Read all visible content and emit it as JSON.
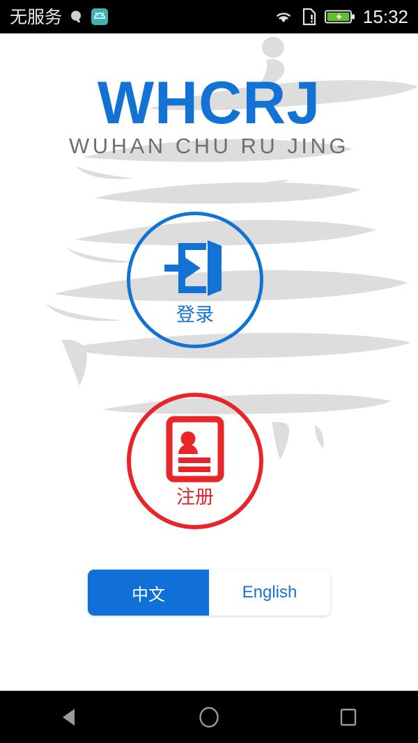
{
  "status_bar": {
    "carrier": "无服务",
    "clock": "15:32",
    "icons": {
      "search": "search-q-icon",
      "app": "android-app-icon",
      "wifi": "wifi-icon",
      "sim": "sim-card-alert-icon",
      "battery": "battery-charging-icon"
    },
    "colors": {
      "background": "#000000",
      "text": "#f0f0f0",
      "battery_fill": "#5FC130",
      "app_icon": "#3FB3B3"
    }
  },
  "logo": {
    "main": "WHCRJ",
    "sub": "WUHAN CHU RU JING",
    "main_color": "#1273D4",
    "sub_color": "#6f6f6f"
  },
  "actions": {
    "login": {
      "label": "登录",
      "icon": "login-door-arrow-icon",
      "color": "#1273D4"
    },
    "register": {
      "label": "注册",
      "icon": "id-card-person-icon",
      "color": "#E8262A"
    }
  },
  "language_toggle": {
    "options": [
      {
        "label": "中文",
        "selected": true
      },
      {
        "label": "English",
        "selected": false
      }
    ],
    "active_bg": "#1070D8",
    "active_text": "#ffffff",
    "inactive_text": "#1273D4"
  },
  "background": {
    "watermark": "yellow-crane-tower-pagoda-watermark",
    "watermark_color": "#C9C9C9"
  },
  "nav_bar": {
    "back": "back-triangle-icon",
    "home": "home-circle-icon",
    "recents": "recents-square-icon",
    "color": "#9a9a9a"
  }
}
